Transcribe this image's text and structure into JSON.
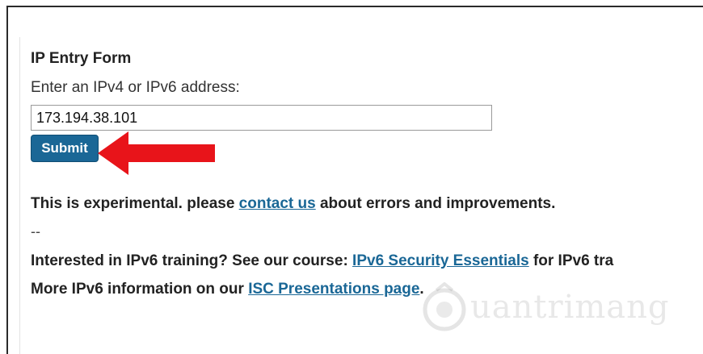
{
  "form": {
    "title": "IP Entry Form",
    "label": "Enter an IPv4 or IPv6 address:",
    "ip_value": "173.194.38.101",
    "submit_label": "Submit"
  },
  "notice": {
    "text_before": "This is experimental. please ",
    "link": "contact us",
    "text_after": " about errors and improvements."
  },
  "separator": "--",
  "training": {
    "text_before": "Interested in IPv6 training? See our course: ",
    "link": "IPv6 Security Essentials",
    "text_after": " for IPv6 tra"
  },
  "more_info": {
    "text_before": "More IPv6 information on our ",
    "link": "ISC Presentations page",
    "text_after": "."
  },
  "watermark": {
    "text": "uantrimang"
  },
  "colors": {
    "accent": "#1a6796",
    "arrow": "#e8141a"
  }
}
